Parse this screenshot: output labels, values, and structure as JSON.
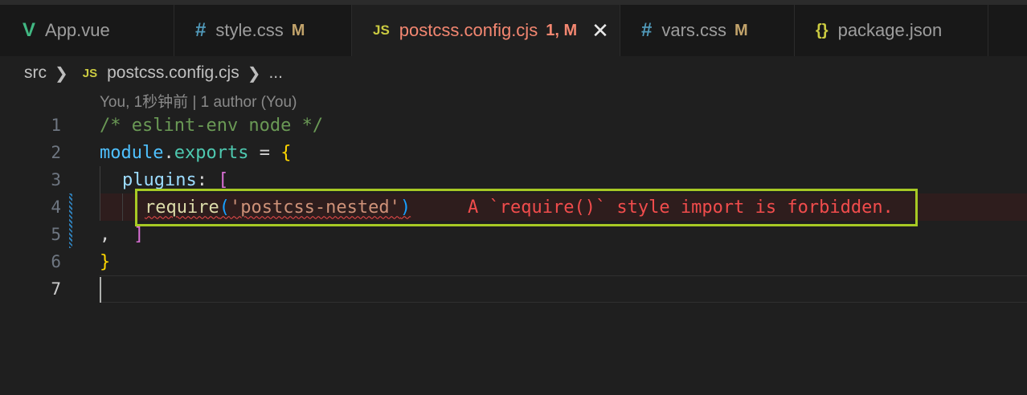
{
  "tabs": [
    {
      "label": "App.vue",
      "icon": "vue-icon",
      "icon_glyph": "V",
      "modified": "",
      "active": false
    },
    {
      "label": "style.css",
      "icon": "css-hash-icon",
      "icon_glyph": "#",
      "modified": "M",
      "active": false
    },
    {
      "label": "postcss.config.cjs",
      "icon": "js-icon",
      "icon_glyph": "JS",
      "modified": "1, M",
      "active": true
    },
    {
      "label": "vars.css",
      "icon": "css-hash-icon",
      "icon_glyph": "#",
      "modified": "M",
      "active": false
    },
    {
      "label": "package.json",
      "icon": "json-braces-icon",
      "icon_glyph": "{}",
      "modified": "",
      "active": false
    }
  ],
  "close_glyph": "✕",
  "breadcrumb": {
    "folder": "src",
    "file_icon": "JS",
    "file": "postcss.config.cjs",
    "ellipsis": "..."
  },
  "blame": "You, 1秒钟前 | 1 author (You)",
  "lines": {
    "l1": {
      "num": "1",
      "comment": "/* eslint-env node */"
    },
    "l2": {
      "num": "2",
      "module": "module",
      "dot": ".",
      "exports": "exports",
      "eq": " = ",
      "brace": "{"
    },
    "l3": {
      "num": "3",
      "plugins": "plugins",
      "colon": ": ",
      "bracket": "["
    },
    "l4": {
      "num": "4",
      "require": "require",
      "open": "(",
      "str": "'postcss-nested'",
      "close": ")",
      "error": "A `require()` style import is forbidden."
    },
    "l5": {
      "num": "5",
      "comma": ",",
      "bracket": "]"
    },
    "l6": {
      "num": "6",
      "brace": "}"
    },
    "l7": {
      "num": "7"
    }
  },
  "colors": {
    "error": "#f14c4c",
    "highlight_box": "#a7c924",
    "active_tab_text": "#f48771"
  }
}
